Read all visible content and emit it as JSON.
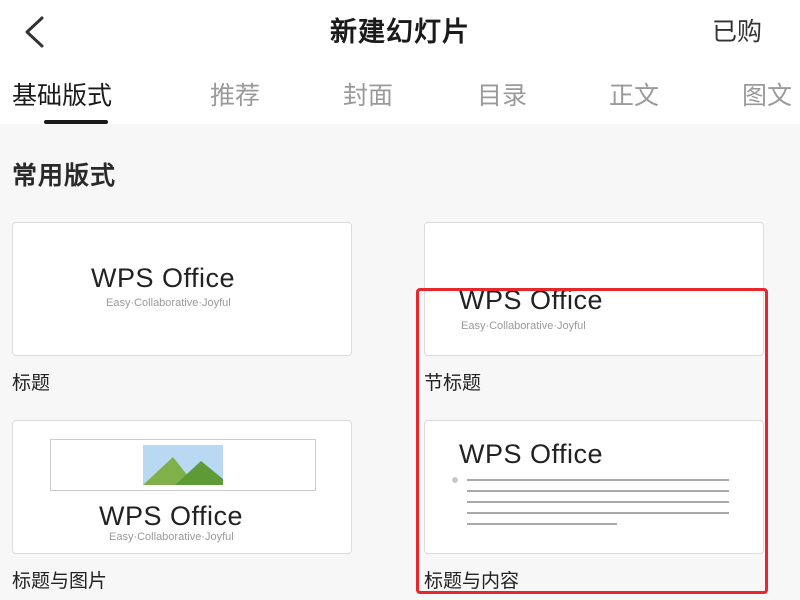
{
  "header": {
    "title": "新建幻灯片",
    "purchased_label": "已购"
  },
  "tabs": [
    {
      "label": "基础版式",
      "active": true
    },
    {
      "label": "推荐",
      "active": false
    },
    {
      "label": "封面",
      "active": false
    },
    {
      "label": "目录",
      "active": false
    },
    {
      "label": "正文",
      "active": false
    },
    {
      "label": "图文",
      "active": false
    }
  ],
  "section": {
    "title": "常用版式"
  },
  "layouts": [
    {
      "label": "标题",
      "brand": "WPS Office",
      "tagline": "Easy·Collaborative·Joyful"
    },
    {
      "label": "节标题",
      "brand": "WPS Office",
      "tagline": "Easy·Collaborative·Joyful"
    },
    {
      "label": "标题与图片",
      "brand": "WPS Office",
      "tagline": "Easy·Collaborative·Joyful"
    },
    {
      "label": "标题与内容",
      "brand": "WPS Office",
      "highlighted": true
    }
  ],
  "colors": {
    "highlight": "#e8262b",
    "active_tab": "#1a1a1a",
    "inactive_tab": "#9a9a9a",
    "sky": "#b9d9f2",
    "mountain_back": "#7fb04a",
    "mountain_front": "#5e9a36"
  },
  "icons": {
    "back": "chevron-left-icon",
    "picture": "landscape-image-icon"
  }
}
